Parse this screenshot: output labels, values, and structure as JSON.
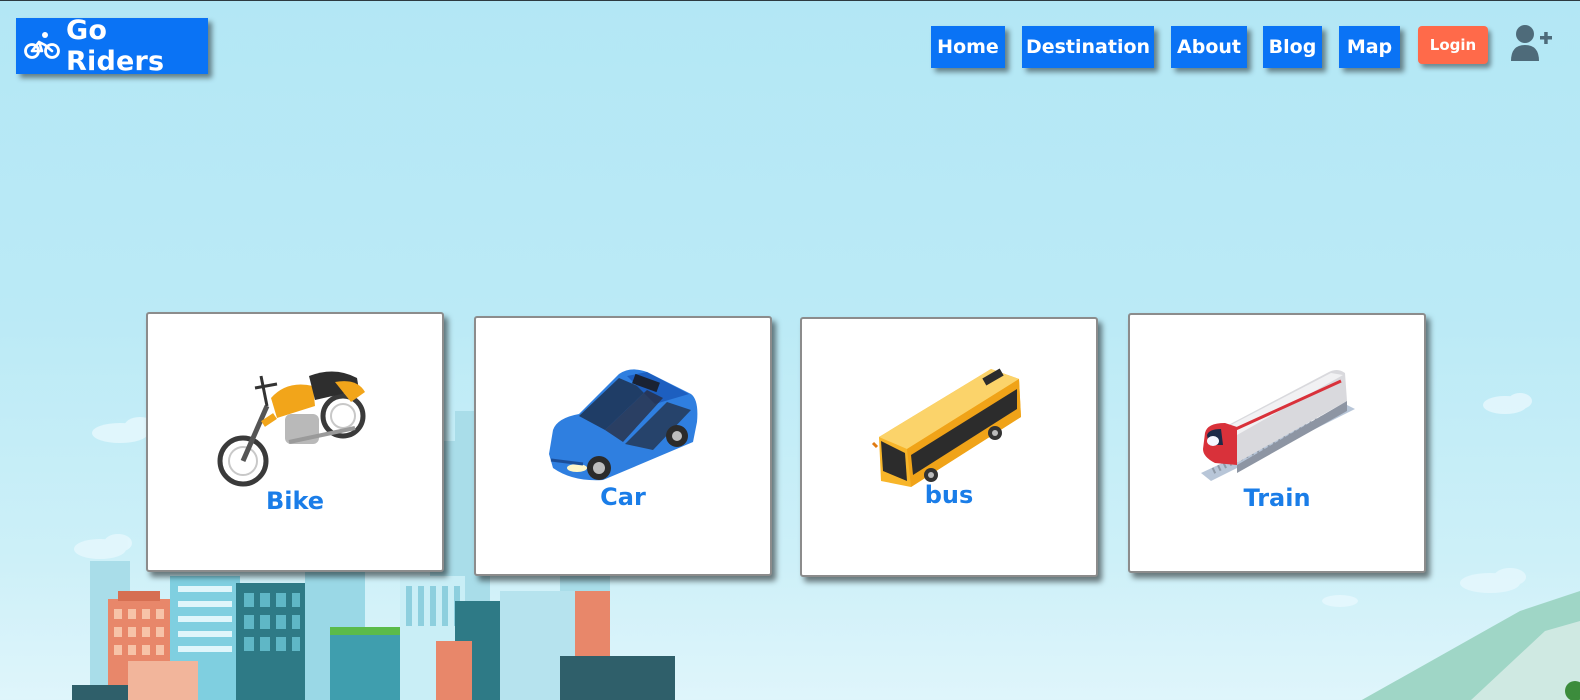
{
  "brand": {
    "name": "Go Riders",
    "icon": "bicycle-icon",
    "color": "#0a73f5"
  },
  "nav": {
    "items": [
      {
        "label": "Home"
      },
      {
        "label": "Destination"
      },
      {
        "label": "About"
      },
      {
        "label": "Blog"
      },
      {
        "label": "Map"
      }
    ],
    "login_label": "Login",
    "login_color": "#ff6a4a",
    "user_icon": "user-plus-icon"
  },
  "vehicles": [
    {
      "label": "Bike",
      "icon": "motorcycle-icon"
    },
    {
      "label": "Car",
      "icon": "car-icon"
    },
    {
      "label": "bus",
      "icon": "bus-icon"
    },
    {
      "label": "Train",
      "icon": "train-icon"
    }
  ],
  "colors": {
    "sky": "#b3e7f5",
    "label": "#1a7de8"
  }
}
